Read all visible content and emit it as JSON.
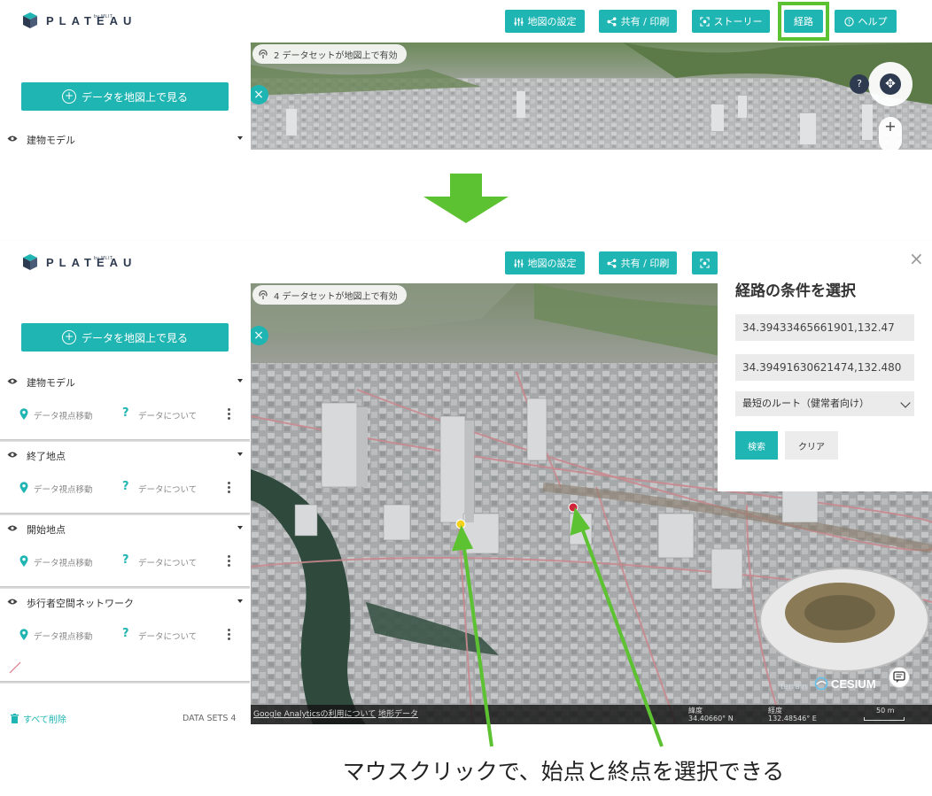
{
  "brand": {
    "name": "PLATEAU",
    "sub": "by MLIT"
  },
  "toolbar": {
    "map_settings": "地図の設定",
    "share_print": "共有 / 印刷",
    "story": "ストーリー",
    "route": "経路",
    "help": "ヘルプ"
  },
  "top": {
    "view_data_button": "データを地図上で見る",
    "datasets_badge": "2 データセットが地図上で有効",
    "layers": [
      {
        "title": "建物モデル"
      }
    ]
  },
  "bottom": {
    "view_data_button": "データを地図上で見る",
    "datasets_badge": "4 データセットが地図上で有効",
    "layers": [
      {
        "title": "建物モデル",
        "move": "データ視点移動",
        "about": "データについて"
      },
      {
        "title": "終了地点",
        "move": "データ視点移動",
        "about": "データについて"
      },
      {
        "title": "開始地点",
        "move": "データ視点移動",
        "about": "データについて"
      },
      {
        "title": "歩行者空間ネットワーク",
        "move": "データ視点移動",
        "about": "データについて"
      }
    ],
    "remove_all": "すべて削除",
    "data_sets_count": "DATA SETS 4",
    "attribution_ga": "Google Analyticsの利用について",
    "attribution_terrain": "地形データ",
    "lat_label": "緯度",
    "lat_value": "34.40660° N",
    "lon_label": "経度",
    "lon_value": "132.48546° E",
    "scale": "50 m",
    "cesium": "CESIUM"
  },
  "route_panel": {
    "title": "経路の条件を選択",
    "start_value": "34.39433465661901,132.47",
    "end_value": "34.39491630621474,132.480",
    "route_type": "最短のルート（健常者向け）",
    "search": "検索",
    "clear": "クリア"
  },
  "compass": {
    "help": "?"
  },
  "caption": "マウスクリックで、始点と終点を選択できる",
  "colors": {
    "accent": "#1fb5b3",
    "highlight": "#5dc232",
    "start_marker": "#f2d21b",
    "end_marker": "#d0263c"
  }
}
